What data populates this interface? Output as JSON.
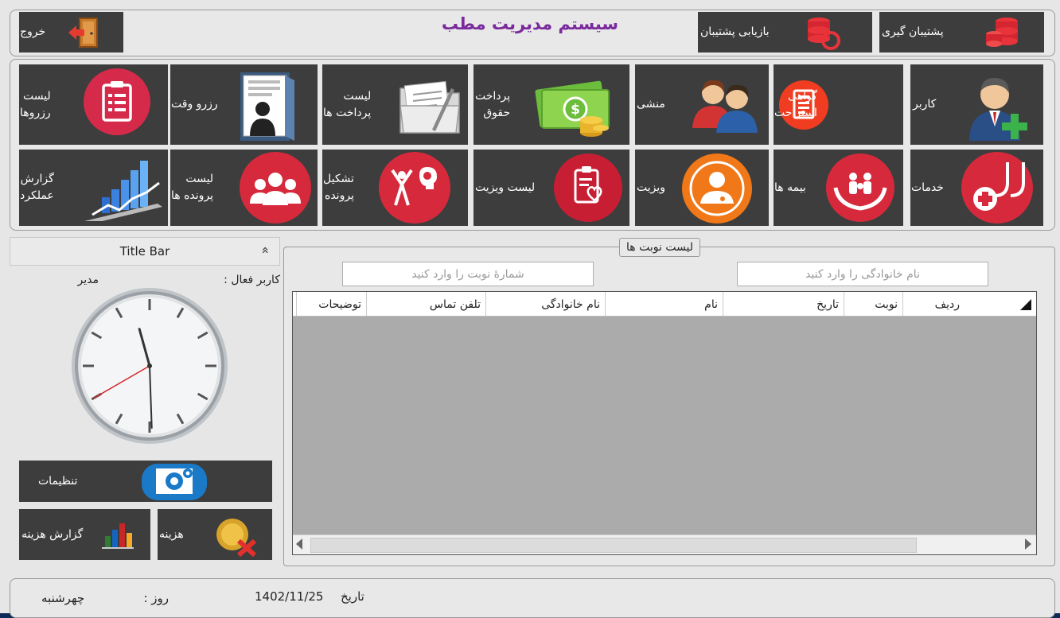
{
  "header": {
    "title": "سیستم مدیریت مطب",
    "exit_label": "خروج",
    "backup_label": "پشتیبان گیری",
    "restore_label": "بازیابی پشتیبان"
  },
  "menu": {
    "user": "کاربر",
    "rest_certificate": "گواهی\nاستراحت",
    "secretary": "منشی",
    "salary_payment": "پرداخت\nحقوق",
    "payments_list": "لیست\nپرداخت ها",
    "reservation": "رزرو وقت",
    "reservations_list": "لیست\nرزروها",
    "services": "خدمات",
    "insurances": "بیمه ها",
    "visit": "ویزیت",
    "visit_list": "لیست ویزیت",
    "create_file": "تشکیل\nپرونده",
    "files_list": "لیست\nپرونده ها",
    "performance_report": "گزارش\nعملکرد"
  },
  "side": {
    "title_bar": "Title Bar",
    "collapse_glyph": "«",
    "active_user_label": "کاربر فعال :",
    "active_user_value": "مدیر",
    "settings": "تنظیمات",
    "expense": "هزینه",
    "expense_report": "گزارش هزینه"
  },
  "appointments": {
    "group_title": "لیست نوبت ها",
    "family_placeholder": "نام خانوادگی را وارد کنید",
    "number_placeholder": "شمارهٔ نوبت را وارد کنید",
    "columns": [
      "ردیف",
      "نوبت",
      "تاریخ",
      "نام",
      "نام خانوادگی",
      "تلفن تماس",
      "توضیحات"
    ],
    "rows": []
  },
  "status": {
    "date_label": "تاریخ",
    "date_value": "1402/11/25",
    "day_label": "روز :",
    "day_value": "چهرشنبه"
  },
  "clock": {
    "hour": 11,
    "minute": 29,
    "second": 40
  },
  "colors": {
    "title": "#7a2a9c",
    "button_bg": "#3d3d3d",
    "accent_red": "#d62a3c",
    "accent_orange": "#f07818"
  }
}
